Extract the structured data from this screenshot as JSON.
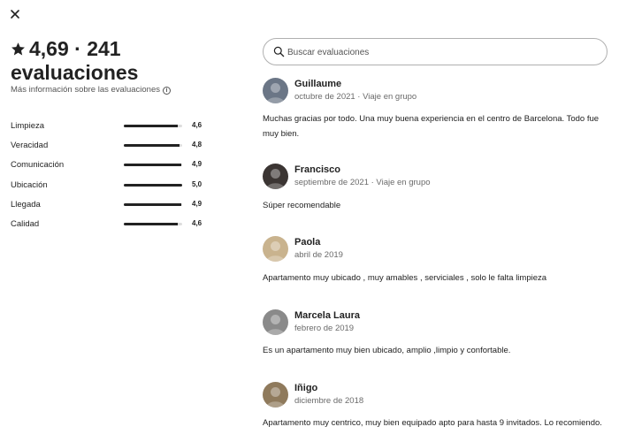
{
  "close": {
    "icon": "close-icon"
  },
  "summary": {
    "star_icon": "star-icon",
    "title": "4,69 · 241 evaluaciones",
    "more_info": "Más información sobre las evaluaciones",
    "info_icon": "i"
  },
  "ratings": [
    {
      "label": "Limpieza",
      "value": "4,6",
      "fraction": 0.92
    },
    {
      "label": "Veracidad",
      "value": "4,8",
      "fraction": 0.96
    },
    {
      "label": "Comunicación",
      "value": "4,9",
      "fraction": 0.98
    },
    {
      "label": "Ubicación",
      "value": "5,0",
      "fraction": 1.0
    },
    {
      "label": "Llegada",
      "value": "4,9",
      "fraction": 0.98
    },
    {
      "label": "Calidad",
      "value": "4,6",
      "fraction": 0.92
    }
  ],
  "search": {
    "placeholder": "Buscar evaluaciones",
    "value": ""
  },
  "reviews": [
    {
      "name": "Guillaume",
      "meta": "octubre de 2021 · Viaje en grupo",
      "text": "Muchas gracias por todo. Una muy buena experiencia en el centro de Barcelona. Todo fue muy bien.",
      "avatar_color": "#6b7686"
    },
    {
      "name": "Francisco",
      "meta": "septiembre de 2021 · Viaje en grupo",
      "text": "Súper recomendable",
      "avatar_color": "#3b3533"
    },
    {
      "name": "Paola",
      "meta": "abril de 2019",
      "text": "Apartamento muy ubicado , muy amables , serviciales , solo le falta limpieza",
      "avatar_color": "#c9b38e"
    },
    {
      "name": "Marcela Laura",
      "meta": "febrero de 2019",
      "text": "Es un apartamento muy bien ubicado, amplio ,limpio y confortable.",
      "avatar_color": "#8a8a8a"
    },
    {
      "name": "Iñigo",
      "meta": "diciembre de 2018",
      "text": "Apartamento muy centrico, muy bien equipado apto para hasta 9 invitados. Lo recomiendo.",
      "avatar_color": "#8f7a5c"
    }
  ]
}
